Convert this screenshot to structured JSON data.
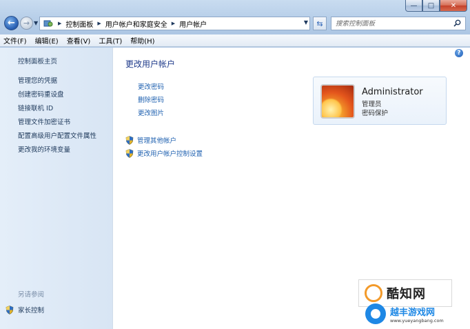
{
  "window": {
    "caption": {
      "minimize": "—",
      "maximize": "□",
      "close": "✕"
    }
  },
  "nav": {
    "back": "←",
    "forward": "→",
    "address_crumbs": [
      "控制面板",
      "用户帐户和家庭安全",
      "用户帐户"
    ],
    "search_placeholder": "搜索控制面板"
  },
  "menu": [
    "文件(F)",
    "编辑(E)",
    "查看(V)",
    "工具(T)",
    "帮助(H)"
  ],
  "sidebar": {
    "home": "控制面板主页",
    "links": [
      "管理您的凭据",
      "创建密码重设盘",
      "链接联机 ID",
      "管理文件加密证书",
      "配置高级用户配置文件属性",
      "更改我的环境变量"
    ],
    "see_also": "另请参阅",
    "parental_control": "家长控制"
  },
  "main": {
    "title": "更改用户帐户",
    "tasks": [
      "更改密码",
      "删除密码",
      "更改图片"
    ],
    "shield_tasks": [
      "管理其他帐户",
      "更改用户帐户控制设置"
    ]
  },
  "user": {
    "name": "Administrator",
    "role": "管理员",
    "password_status": "密码保护"
  },
  "watermarks": {
    "site1": "酷知网",
    "site2": "越丰游戏网",
    "site2_url": "www.yueyangbang.com"
  },
  "colors": {
    "link": "#1f61b0",
    "title": "#1e3a8a",
    "sidebar_bg": "#dfeaf7"
  }
}
